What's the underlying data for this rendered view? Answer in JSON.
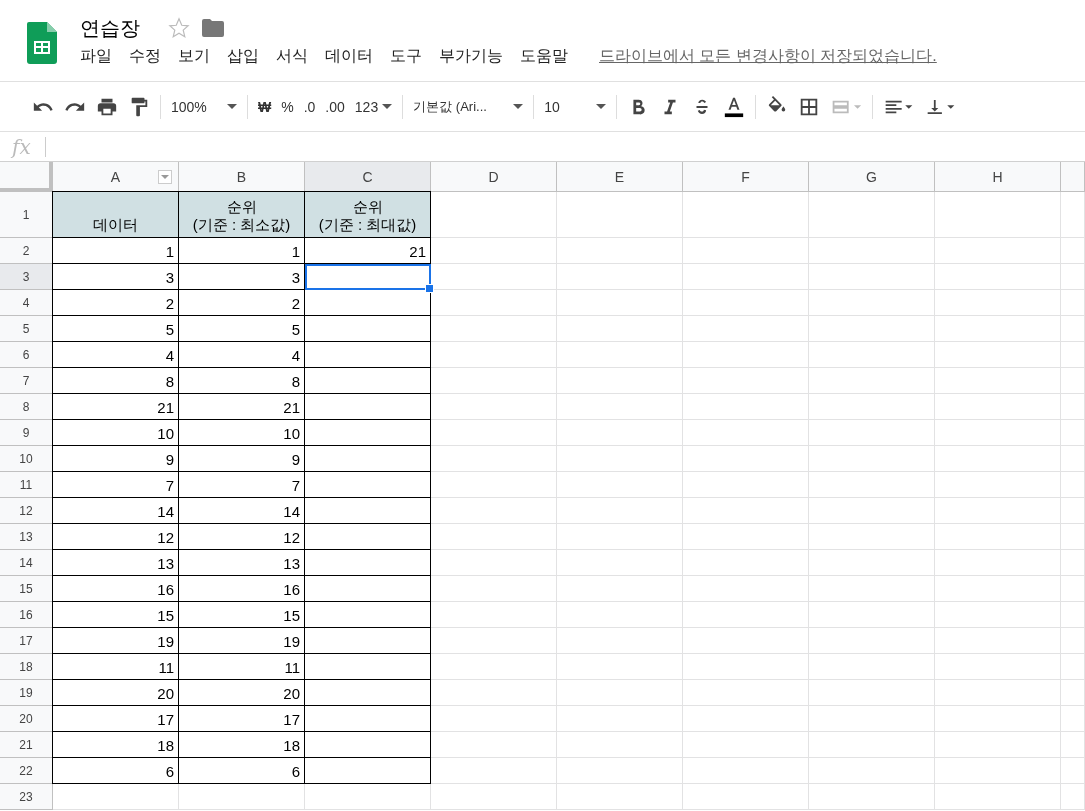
{
  "document": {
    "title": "연습장",
    "starred": false
  },
  "menu": [
    "파일",
    "수정",
    "보기",
    "삽입",
    "서식",
    "데이터",
    "도구",
    "부가기능",
    "도움말"
  ],
  "save_status": "드라이브에서 모든 변경사항이 저장되었습니다.",
  "toolbar": {
    "zoom": "100%",
    "currency": "₩",
    "percent": "%",
    "decrease_decimal": ".0",
    "increase_decimal": ".00",
    "number_format": "123",
    "font": "기본값 (Ari...",
    "font_size": "10"
  },
  "formula_bar": {
    "label": "fx"
  },
  "columns": [
    {
      "label": "A",
      "selected": false,
      "filter": true
    },
    {
      "label": "B",
      "selected": false,
      "filter": false
    },
    {
      "label": "C",
      "selected": true,
      "filter": false
    },
    {
      "label": "D",
      "selected": false,
      "filter": false
    },
    {
      "label": "E",
      "selected": false,
      "filter": false
    },
    {
      "label": "F",
      "selected": false,
      "filter": false
    },
    {
      "label": "G",
      "selected": false,
      "filter": false
    },
    {
      "label": "H",
      "selected": false,
      "filter": false
    }
  ],
  "rows": [
    {
      "number": "1",
      "kind": "header",
      "selected": false,
      "cells": [
        "데이터",
        "순위\n(기준 : 최소값)",
        "순위\n(기준 : 최대값)"
      ]
    },
    {
      "number": "2",
      "kind": "data",
      "selected": false,
      "cells": [
        "1",
        "1",
        "21"
      ]
    },
    {
      "number": "3",
      "kind": "data",
      "selected": true,
      "cells": [
        "3",
        "3",
        ""
      ]
    },
    {
      "number": "4",
      "kind": "data",
      "selected": false,
      "cells": [
        "2",
        "2",
        ""
      ]
    },
    {
      "number": "5",
      "kind": "data",
      "selected": false,
      "cells": [
        "5",
        "5",
        ""
      ]
    },
    {
      "number": "6",
      "kind": "data",
      "selected": false,
      "cells": [
        "4",
        "4",
        ""
      ]
    },
    {
      "number": "7",
      "kind": "data",
      "selected": false,
      "cells": [
        "8",
        "8",
        ""
      ]
    },
    {
      "number": "8",
      "kind": "data",
      "selected": false,
      "cells": [
        "21",
        "21",
        ""
      ]
    },
    {
      "number": "9",
      "kind": "data",
      "selected": false,
      "cells": [
        "10",
        "10",
        ""
      ]
    },
    {
      "number": "10",
      "kind": "data",
      "selected": false,
      "cells": [
        "9",
        "9",
        ""
      ]
    },
    {
      "number": "11",
      "kind": "data",
      "selected": false,
      "cells": [
        "7",
        "7",
        ""
      ]
    },
    {
      "number": "12",
      "kind": "data",
      "selected": false,
      "cells": [
        "14",
        "14",
        ""
      ]
    },
    {
      "number": "13",
      "kind": "data",
      "selected": false,
      "cells": [
        "12",
        "12",
        ""
      ]
    },
    {
      "number": "14",
      "kind": "data",
      "selected": false,
      "cells": [
        "13",
        "13",
        ""
      ]
    },
    {
      "number": "15",
      "kind": "data",
      "selected": false,
      "cells": [
        "16",
        "16",
        ""
      ]
    },
    {
      "number": "16",
      "kind": "data",
      "selected": false,
      "cells": [
        "15",
        "15",
        ""
      ]
    },
    {
      "number": "17",
      "kind": "data",
      "selected": false,
      "cells": [
        "19",
        "19",
        ""
      ]
    },
    {
      "number": "18",
      "kind": "data",
      "selected": false,
      "cells": [
        "11",
        "11",
        ""
      ]
    },
    {
      "number": "19",
      "kind": "data",
      "selected": false,
      "cells": [
        "20",
        "20",
        ""
      ]
    },
    {
      "number": "20",
      "kind": "data",
      "selected": false,
      "cells": [
        "17",
        "17",
        ""
      ]
    },
    {
      "number": "21",
      "kind": "data",
      "selected": false,
      "cells": [
        "18",
        "18",
        ""
      ]
    },
    {
      "number": "22",
      "kind": "data",
      "selected": false,
      "cells": [
        "6",
        "6",
        ""
      ]
    },
    {
      "number": "23",
      "kind": "empty",
      "selected": false
    }
  ]
}
